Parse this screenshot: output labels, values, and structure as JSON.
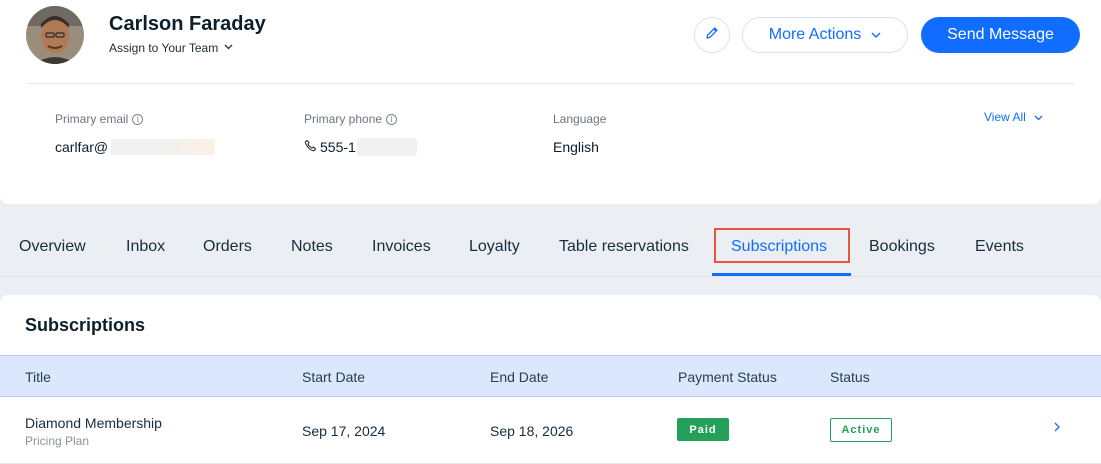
{
  "contact": {
    "name": "Carlson Faraday",
    "assign_label": "Assign to Your Team",
    "assign_icon": "chevron-down-icon",
    "avatar_icon": "avatar-photo"
  },
  "actions": {
    "edit_icon": "pencil-icon",
    "more_label": "More Actions",
    "send_label": "Send Message"
  },
  "info": {
    "email_label": "Primary email",
    "email_value": "carlfar@",
    "phone_label": "Primary phone",
    "phone_value": "555-1",
    "language_label": "Language",
    "language_value": "English",
    "view_all": "View All"
  },
  "tabs": [
    {
      "label": "Overview"
    },
    {
      "label": "Inbox"
    },
    {
      "label": "Orders"
    },
    {
      "label": "Notes"
    },
    {
      "label": "Invoices"
    },
    {
      "label": "Loyalty"
    },
    {
      "label": "Table reservations"
    },
    {
      "label": "Subscriptions"
    },
    {
      "label": "Bookings"
    },
    {
      "label": "Events"
    }
  ],
  "active_tab": "Subscriptions",
  "subscriptions": {
    "title": "Subscriptions",
    "columns": [
      "Title",
      "Start Date",
      "End Date",
      "Payment Status",
      "Status"
    ],
    "rows": [
      {
        "title": "Diamond Membership",
        "subtitle": "Pricing Plan",
        "start_date": "Sep 17, 2024",
        "end_date": "Sep 18, 2026",
        "payment_status": "Paid",
        "status": "Active"
      }
    ]
  },
  "colors": {
    "accent": "#116dff",
    "success": "#25a05a",
    "highlight": "#e9543d"
  }
}
